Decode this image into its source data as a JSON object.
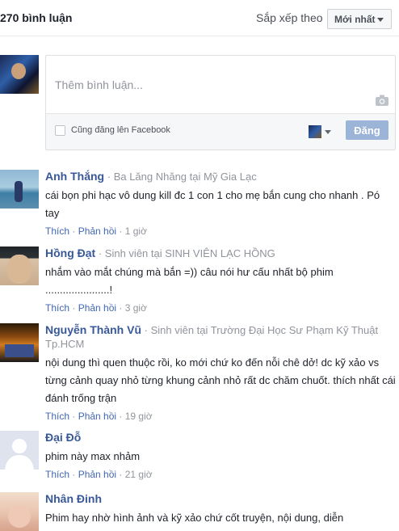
{
  "header": {
    "count_label": "270 bình luận",
    "sort_label": "Sắp xếp theo",
    "sort_value": "Mới nhất"
  },
  "composer": {
    "placeholder": "Thêm bình luận...",
    "share_checkbox_label": "Cũng đăng lên Facebook",
    "post_button": "Đăng"
  },
  "comments": [
    {
      "name": "Anh Thắng",
      "info": "Ba Lăng Nhăng tại Mỹ Gia Lạc",
      "text": "cái bọn phi hạc vô dung kill đc 1 con 1 cho mẹ bắn cung cho nhanh . Pó tay",
      "like": "Thích",
      "reply": "Phản hồi",
      "time": "1 giờ"
    },
    {
      "name": "Hồng Đạt",
      "info": "Sinh viên tại SINH VIÊN LẠC HỒNG",
      "text": "nhắm vào mắt chúng mà bắn =)) câu nói hư cấu nhất bộ phim ......................!",
      "like": "Thích",
      "reply": "Phản hồi",
      "time": "3 giờ"
    },
    {
      "name": "Nguyễn Thành Vũ",
      "info": "Sinh viên tại Trường Đại Học Sư Phạm Kỹ Thuật Tp.HCM",
      "text": "nội dung thì quen thuộc rồi, ko mới chứ ko đến nỗi chê dở! dc kỹ xảo vs từng cảnh quay nhỏ từng khung cảnh nhỏ rất dc chăm chuốt. thích nhất cái đánh trống trận",
      "like": "Thích",
      "reply": "Phản hồi",
      "time": "19 giờ"
    },
    {
      "name": "Đại Đỗ",
      "info": "",
      "text": "phim này max nhảm",
      "like": "Thích",
      "reply": "Phản hồi",
      "time": "21 giờ"
    },
    {
      "name": "Nhân Đinh",
      "info": "",
      "text": "Phim hay nhờ hình ảnh và kỹ xảo chứ cốt truyện, nội dung, diễn",
      "like": "",
      "reply": "",
      "time": ""
    }
  ]
}
